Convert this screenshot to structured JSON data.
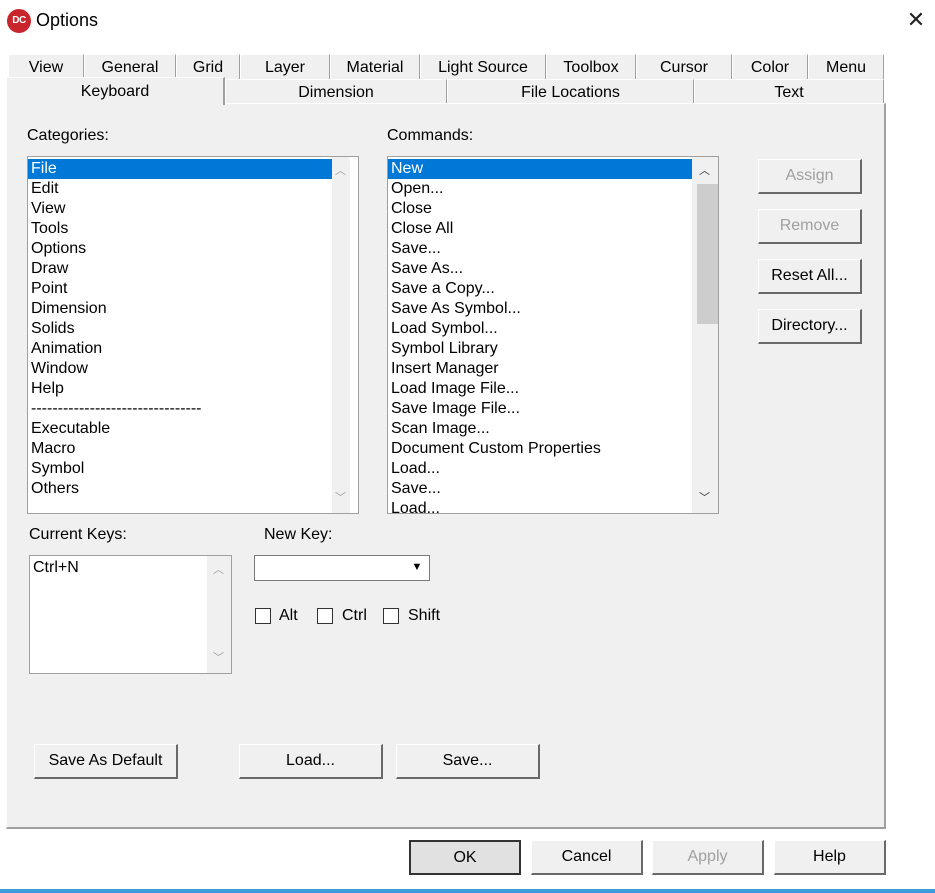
{
  "window": {
    "title": "Options",
    "logo_text": "DC"
  },
  "tabs_row1": [
    "View",
    "General",
    "Grid",
    "Layer",
    "Material",
    "Light Source",
    "Toolbox",
    "Cursor",
    "Color",
    "Menu"
  ],
  "tabs_row2": [
    "Keyboard",
    "Dimension",
    "File Locations",
    "Text"
  ],
  "active_tab": "Keyboard",
  "categories": {
    "label": "Categories:",
    "items": [
      "File",
      "Edit",
      "View",
      "Tools",
      "Options",
      "Draw",
      "Point",
      "Dimension",
      "Solids",
      "Animation",
      "Window",
      "Help",
      "--------------------------------",
      "Executable",
      "Macro",
      "Symbol",
      "Others"
    ],
    "selected": "File"
  },
  "commands": {
    "label": "Commands:",
    "items": [
      "New",
      "Open...",
      "Close",
      "Close All",
      "Save...",
      "Save As...",
      "Save a Copy...",
      "Save As Symbol...",
      "Load Symbol...",
      "Symbol Library",
      "Insert Manager",
      "Load Image File...",
      "Save Image File...",
      "Scan Image...",
      "Document Custom Properties",
      "Load...",
      "Save...",
      "Load..."
    ],
    "selected": "New"
  },
  "side_buttons": {
    "assign": "Assign",
    "remove": "Remove",
    "reset_all": "Reset All...",
    "directory": "Directory..."
  },
  "current_keys": {
    "label": "Current Keys:",
    "items": [
      "Ctrl+N"
    ]
  },
  "new_key": {
    "label": "New Key:",
    "value": ""
  },
  "modifiers": {
    "alt": "Alt",
    "ctrl": "Ctrl",
    "shift": "Shift"
  },
  "panel_buttons": {
    "save_default": "Save As Default",
    "load": "Load...",
    "save": "Save..."
  },
  "dialog_buttons": {
    "ok": "OK",
    "cancel": "Cancel",
    "apply": "Apply",
    "help": "Help"
  },
  "colors": {
    "selection": "#0078d7",
    "logo": "#c9252c"
  }
}
